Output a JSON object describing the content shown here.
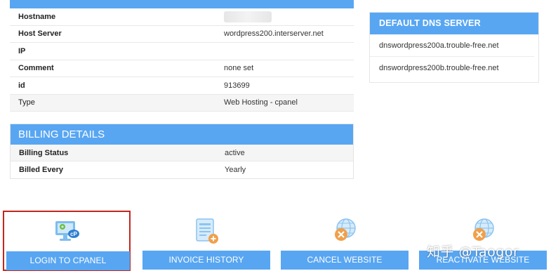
{
  "host_details": {
    "rows": [
      {
        "label": "Hostname",
        "value": ""
      },
      {
        "label": "Host Server",
        "value": "wordpress200.interserver.net"
      },
      {
        "label": "IP",
        "value": ""
      },
      {
        "label": "Comment",
        "value": "none set"
      },
      {
        "label": "id",
        "value": "913699"
      },
      {
        "label": "Type",
        "value": "Web Hosting - cpanel"
      }
    ]
  },
  "billing": {
    "title": "BILLING DETAILS",
    "rows": [
      {
        "label": "Billing Status",
        "value": "active"
      },
      {
        "label": "Billed Every",
        "value": "Yearly"
      }
    ]
  },
  "dns": {
    "title": "DEFAULT DNS SERVER",
    "servers": [
      "dnswordpress200a.trouble-free.net",
      "dnswordpress200b.trouble-free.net"
    ]
  },
  "actions": [
    {
      "label": "LOGIN TO CPANEL",
      "icon": "cpanel-monitor-icon",
      "selected": true
    },
    {
      "label": "INVOICE HISTORY",
      "icon": "invoice-add-icon",
      "selected": false
    },
    {
      "label": "CANCEL WEBSITE",
      "icon": "globe-cancel-icon",
      "selected": false
    },
    {
      "label": "REACTIVATE WEBSITE",
      "icon": "globe-reactivate-icon",
      "selected": false
    }
  ],
  "watermark": "知乎 @Taogor",
  "colors": {
    "accent": "#58a6f2",
    "selection_border": "#c2261e",
    "row_alt": "#f5f5f5",
    "icon_orange": "#f0a04b"
  }
}
